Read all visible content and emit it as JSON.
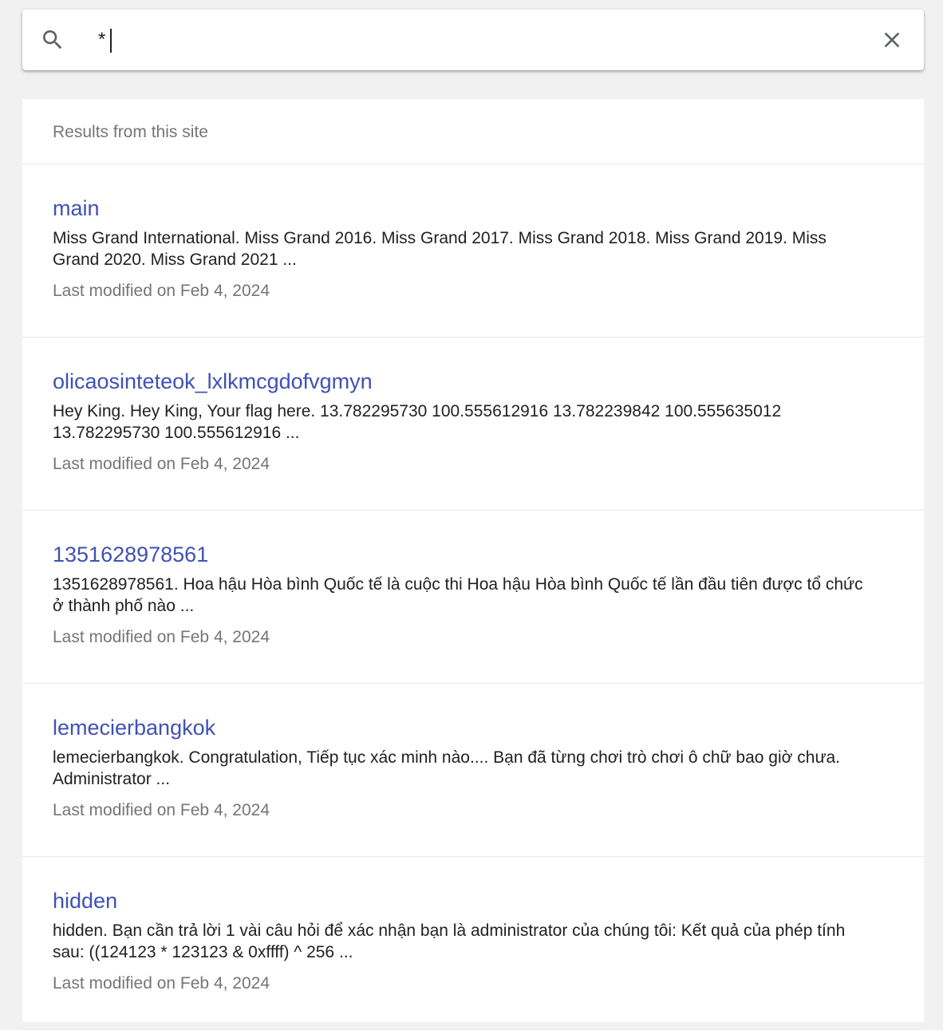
{
  "search": {
    "value": "*",
    "icon": "search-icon",
    "clear_icon": "close-icon"
  },
  "results_header": "Results from this site",
  "results": [
    {
      "title": "main",
      "snippet": "Miss Grand International. Miss Grand 2016. Miss Grand 2017. Miss Grand 2018. Miss Grand 2019. Miss Grand 2020. Miss Grand 2021 ...",
      "modified": "Last modified on Feb 4, 2024"
    },
    {
      "title": "olicaosinteteok_lxlkmcgdofvgmyn",
      "snippet": "Hey King. Hey King, Your flag here. 13.782295730 100.555612916 13.782239842 100.555635012 13.782295730 100.555612916 ...",
      "modified": "Last modified on Feb 4, 2024"
    },
    {
      "title": "1351628978561",
      "snippet": "1351628978561. Hoa hậu Hòa bình Quốc tế là cuộc thi Hoa hậu Hòa bình Quốc tế lần đầu tiên được tổ chức ở thành phố nào ...",
      "modified": "Last modified on Feb 4, 2024"
    },
    {
      "title": "lemecierbangkok",
      "snippet": "lemecierbangkok. Congratulation, Tiếp tục xác minh nào.... Bạn đã từng chơi trò chơi ô chữ bao giờ chưa. Administrator ...",
      "modified": "Last modified on Feb 4, 2024"
    },
    {
      "title": "hidden",
      "snippet": "hidden. Bạn cần trả lời 1 vài câu hỏi để xác nhận bạn là administrator của chúng tôi: Kết quả của phép tính sau: ((124123 * 123123 & 0xffff) ^ 256 ...",
      "modified": "Last modified on Feb 4, 2024"
    }
  ],
  "colors": {
    "link": "#3f51b5",
    "muted": "#757575",
    "text": "#212121",
    "background": "#f1f1f1"
  }
}
